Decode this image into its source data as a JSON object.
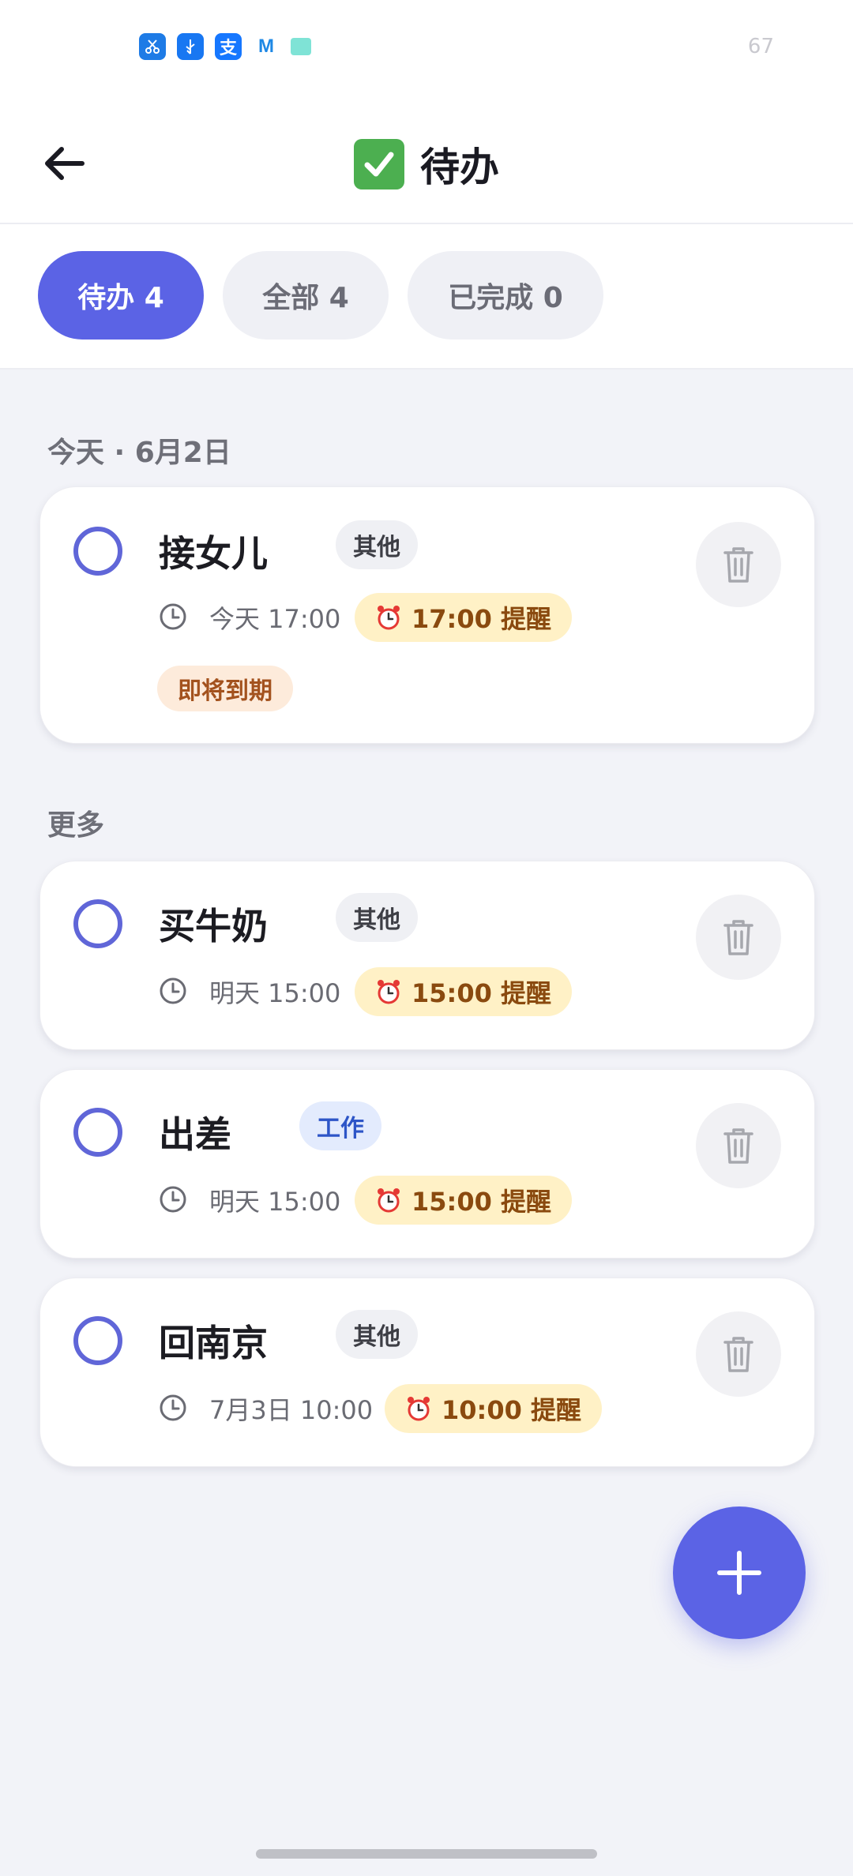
{
  "status_bar": {
    "icons": [
      "scissors-app-icon",
      "usb-icon",
      "alipay-icon",
      "m-app-icon",
      "teal-app-icon"
    ],
    "battery": "67"
  },
  "header": {
    "title": "待办",
    "title_icon": "check-mark-emoji"
  },
  "filters": [
    {
      "label": "待办 4",
      "active": true
    },
    {
      "label": "全部 4",
      "active": false
    },
    {
      "label": "已完成 0",
      "active": false
    }
  ],
  "sections": {
    "today": "今天 · 6月2日",
    "more": "更多"
  },
  "todos": [
    {
      "title": "接女儿",
      "tag": "其他",
      "time": "今天 17:00",
      "reminder": "17:00 提醒",
      "badge": "即将到期"
    },
    {
      "title": "买牛奶",
      "tag": "其他",
      "time": "明天 15:00",
      "reminder": "15:00 提醒"
    },
    {
      "title": "出差",
      "tag": "工作",
      "time": "明天 15:00",
      "reminder": "15:00 提醒"
    },
    {
      "title": "回南京",
      "tag": "其他",
      "time": "7月3日 10:00",
      "reminder": "10:00 提醒"
    }
  ],
  "colors": {
    "accent": "#5B63E5",
    "background": "#F2F3F8",
    "reminder_bg": "#FFF1C6",
    "due_bg": "#FDEBDB"
  }
}
